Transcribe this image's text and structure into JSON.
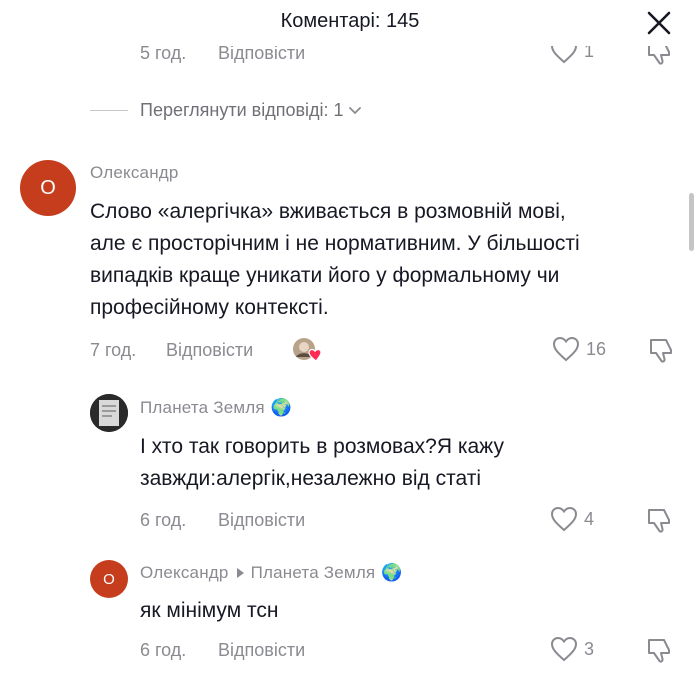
{
  "header": {
    "title": "Коментарі: 145"
  },
  "top_partial": {
    "time": "5 год.",
    "reply": "Відповісти",
    "likes": "1"
  },
  "view_replies": {
    "label": "Переглянути відповіді: 1"
  },
  "comments": [
    {
      "author": "Олександр",
      "avatar_letter": "O",
      "text_lines": [
        "Слово «алергічка» вживається в розмовній мові,",
        "але є просторічним і не нормативним. У більшості",
        "випадків краще уникати його у формальному чи",
        "професійному контексті."
      ],
      "time": "7 год.",
      "reply": "Відповісти",
      "likes": "16"
    }
  ],
  "replies": [
    {
      "author": "Планета Земля",
      "author_emoji": "🌍",
      "text_lines": [
        "І хто так говорить в розмовах?Я кажу",
        "завжди:алергік,незалежно від статі"
      ],
      "time": "6 год.",
      "reply": "Відповісти",
      "likes": "4"
    },
    {
      "author": "Олександр",
      "reply_to": "Планета Земля",
      "author_emoji": "🌍",
      "avatar_letter": "O",
      "text_lines": [
        "як мінімум тсн"
      ],
      "time": "6 год.",
      "reply": "Відповісти",
      "likes": "3"
    }
  ],
  "colors": {
    "accent_avatar": "#c63d1e",
    "secondary_text": "#8a8b91",
    "primary_text": "#161823",
    "heart_red": "#fe2c55"
  },
  "icons": [
    "close-icon",
    "chevron-down-icon",
    "heart-icon",
    "dislike-icon",
    "creator-liked-icon",
    "globe-emoji-icon",
    "reply-arrow-icon"
  ]
}
